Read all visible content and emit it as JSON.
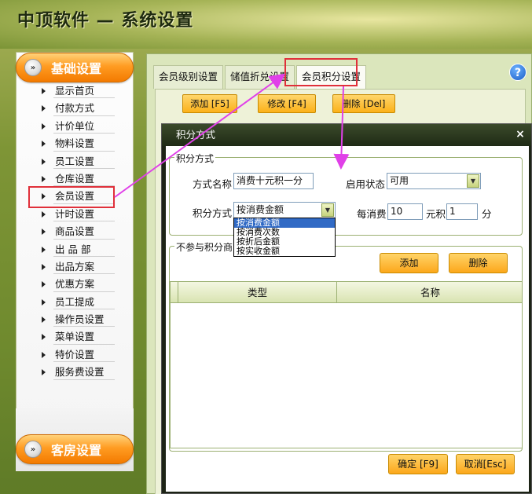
{
  "app": {
    "title": "中顶软件 — 系统设置"
  },
  "sidebar": {
    "top_button": "基础设置",
    "bottom_button": "客房设置",
    "items": [
      {
        "label": "显示首页"
      },
      {
        "label": "付款方式"
      },
      {
        "label": "计价单位"
      },
      {
        "label": "物料设置"
      },
      {
        "label": "员工设置"
      },
      {
        "label": "仓库设置"
      },
      {
        "label": "会员设置"
      },
      {
        "label": "计时设置"
      },
      {
        "label": "商品设置"
      },
      {
        "label": "出 品 部"
      },
      {
        "label": "出品方案"
      },
      {
        "label": "优惠方案"
      },
      {
        "label": "员工提成"
      },
      {
        "label": "操作员设置"
      },
      {
        "label": "菜单设置"
      },
      {
        "label": "特价设置"
      },
      {
        "label": "服务费设置"
      }
    ]
  },
  "tabs": [
    {
      "label": "会员级别设置"
    },
    {
      "label": "储值折兑设置"
    },
    {
      "label": "会员积分设置"
    }
  ],
  "toolbar": {
    "add": "添加 [F5]",
    "edit": "修改 [F4]",
    "delete": "删除 [Del]"
  },
  "dialog": {
    "title": "积分方式",
    "close": "×",
    "group1_title": "积分方式",
    "name_label": "方式名称",
    "name_value": "消费十元积一分",
    "status_label": "启用状态",
    "status_value": "可用",
    "mode_label": "积分方式",
    "mode_value": "按消费金额",
    "per_label": "每消费",
    "per_value": "10",
    "yuan_label": "元积",
    "points_value": "1",
    "fen_label": "分",
    "dropdown_options": [
      "按消费金额",
      "按消费次数",
      "按折后金额",
      "按实收金额"
    ],
    "group2_title": "不参与积分商品",
    "add_button": "添加",
    "delete_button": "删除",
    "grid_columns": [
      "类型",
      "名称"
    ],
    "ok_button": "确定 [F9]",
    "cancel_button": "取消[Esc]"
  },
  "colors": {
    "accent_orange": "#fba11a",
    "highlight_red": "#e0303a",
    "annotation_arrow": "#e040e8"
  }
}
